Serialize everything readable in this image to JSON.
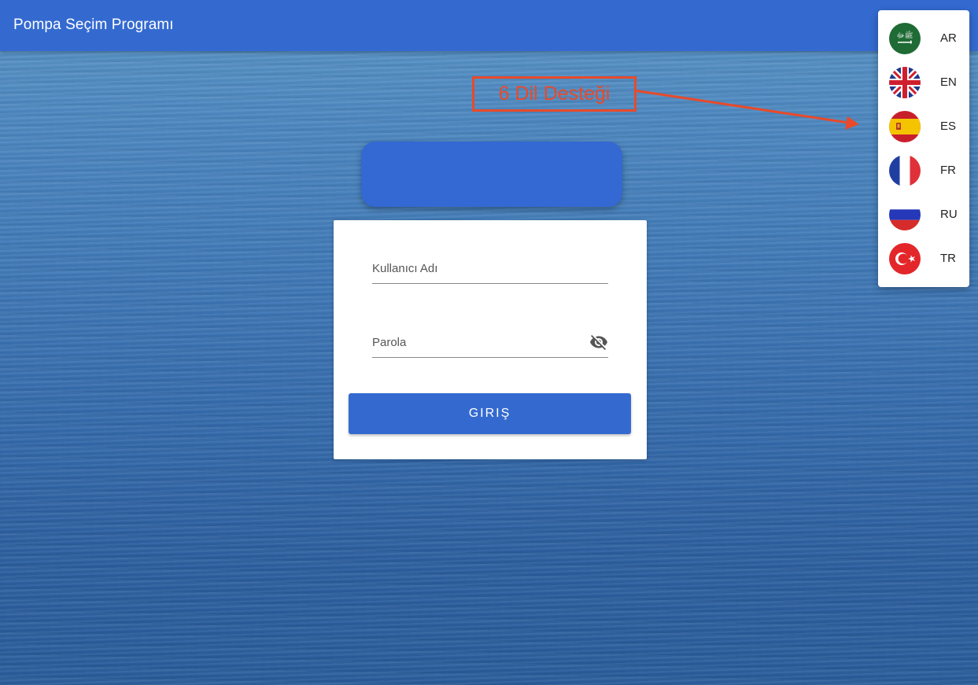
{
  "app": {
    "title": "Pompa Seçim Programı"
  },
  "login": {
    "username_placeholder": "Kullanıcı Adı",
    "password_placeholder": "Parola",
    "submit_label": "GIRIŞ"
  },
  "annotation": {
    "text": "6 Dil Desteği"
  },
  "languages": [
    {
      "code": "AR",
      "flag": "saudi-arabia-flag-icon"
    },
    {
      "code": "EN",
      "flag": "united-kingdom-flag-icon"
    },
    {
      "code": "ES",
      "flag": "spain-flag-icon"
    },
    {
      "code": "FR",
      "flag": "france-flag-icon"
    },
    {
      "code": "RU",
      "flag": "russia-flag-icon"
    },
    {
      "code": "TR",
      "flag": "turkey-flag-icon"
    }
  ],
  "colors": {
    "primary": "#346ad0",
    "annotation": "#e84a2a"
  }
}
